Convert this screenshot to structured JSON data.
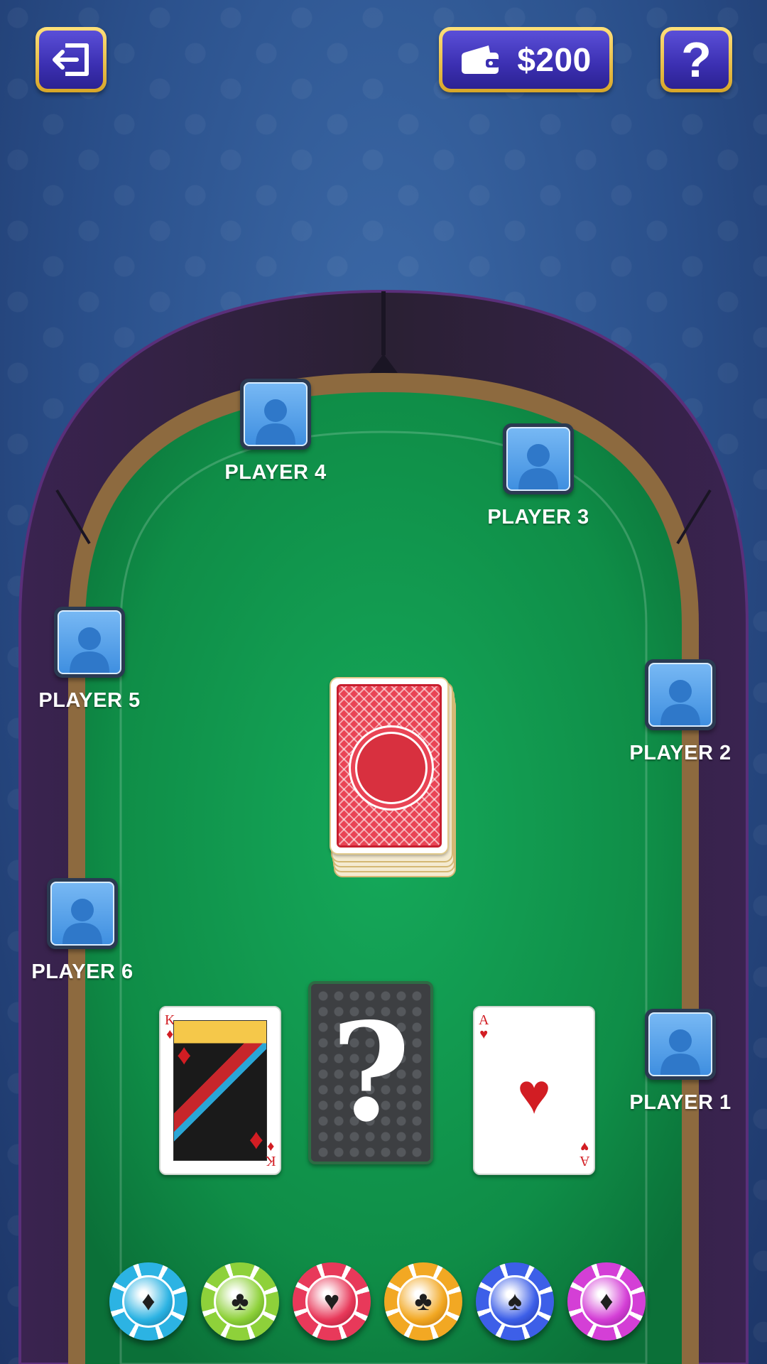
{
  "top_bar": {
    "exit_icon": "exit-icon",
    "wallet_icon": "wallet-icon",
    "wallet_amount": "$200",
    "help_label": "?"
  },
  "players": [
    {
      "name": "PLAYER 1"
    },
    {
      "name": "PLAYER 2"
    },
    {
      "name": "PLAYER 3"
    },
    {
      "name": "PLAYER 4"
    },
    {
      "name": "PLAYER 5"
    },
    {
      "name": "PLAYER 6"
    }
  ],
  "cards": {
    "left": {
      "rank": "K",
      "suit": "♦",
      "suit_name": "diamonds"
    },
    "middle": {
      "label": "?"
    },
    "right": {
      "rank": "A",
      "suit": "♥",
      "suit_name": "hearts"
    }
  },
  "chips": [
    {
      "color": "#2cb3e3",
      "dark": "#0d6d95",
      "suit": "♦",
      "name": "chip-cyan-diamond"
    },
    {
      "color": "#8ed13a",
      "dark": "#4b8a16",
      "suit": "♣",
      "name": "chip-green-club"
    },
    {
      "color": "#e8395a",
      "dark": "#9d142f",
      "suit": "♥",
      "name": "chip-red-heart"
    },
    {
      "color": "#f2a823",
      "dark": "#b26a06",
      "suit": "♣",
      "name": "chip-orange-club"
    },
    {
      "color": "#3d5fe8",
      "dark": "#1c2f9c",
      "suit": "♠",
      "name": "chip-blue-spade"
    },
    {
      "color": "#d43fd6",
      "dark": "#8a1a90",
      "suit": "♦",
      "name": "chip-magenta-diamond"
    }
  ],
  "colors": {
    "felt": "#11984d",
    "rail_wood": "#8d6a3f",
    "button_border": "#f0c64a",
    "button_fill": "#3b2fb1",
    "avatar": "#4a97e6"
  }
}
